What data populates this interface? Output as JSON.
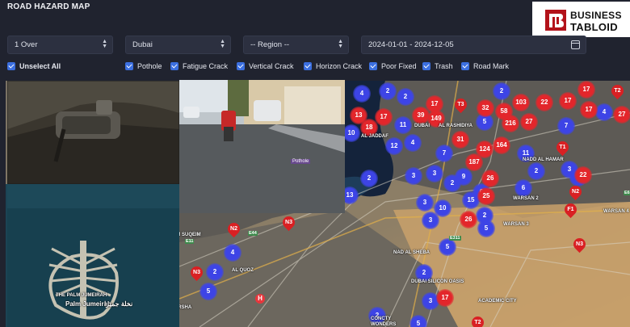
{
  "header": {
    "title": "ROAD HAZARD MAP"
  },
  "brand": {
    "line1": "BUSINESS",
    "line2": "TABLOID"
  },
  "filters": {
    "count_select": "1 Over",
    "city_select": "Dubai",
    "region_select": "-- Region --",
    "date_range": "2024-01-01 - 2024-12-05"
  },
  "checkboxes": {
    "unselect_all": "Unselect All",
    "items": [
      "Pothole",
      "Fatigue Crack",
      "Vertical Crack",
      "Horizon Crack",
      "Poor Fixed",
      "Trash",
      "Road Mark"
    ]
  },
  "photo": {
    "detection_label": "Pothole",
    "caption_ar": "نخلة جميرا"
  },
  "map": {
    "labels": [
      "TEJARI",
      "AL RASHIDIYA",
      "DUBAI",
      "INTERNATIONAL",
      "AL JADDAF",
      "NADD AL HAMAR",
      "AL QUOZ",
      "AL BARSHA",
      "UMM SUQEIM",
      "THE PALM JUMEIRAH",
      "Palm Jumeirah",
      "NAD AL SHEBA",
      "DUBAI SILICON OASIS",
      "ACADEMIC CITY",
      "WARSAN 2",
      "WARSAN 3",
      "WARSAN 4",
      "NADD AL HAMAR",
      "CONCTY",
      "WONDERS"
    ],
    "blue_clusters": [
      "2",
      "2",
      "4",
      "10",
      "12",
      "11",
      "7",
      "3",
      "4",
      "9",
      "5",
      "15",
      "2",
      "3",
      "2",
      "5",
      "11",
      "2",
      "3",
      "7",
      "3",
      "4",
      "6",
      "2",
      "2",
      "2",
      "5",
      "3",
      "2",
      "4",
      "2",
      "5",
      "3",
      "10",
      "3",
      "6",
      "13",
      "5"
    ],
    "red_clusters": [
      "17",
      "32",
      "58",
      "103",
      "22",
      "17",
      "17",
      "27",
      "13",
      "18",
      "17",
      "39",
      "149",
      "31",
      "124",
      "164",
      "187",
      "26",
      "25",
      "26",
      "22",
      "216",
      "27",
      "17",
      "17"
    ],
    "pins": [
      "T3",
      "T1",
      "T2",
      "N2",
      "N3",
      "N3",
      "N2",
      "F1",
      "N3",
      "T2"
    ],
    "hospital": "H"
  }
}
